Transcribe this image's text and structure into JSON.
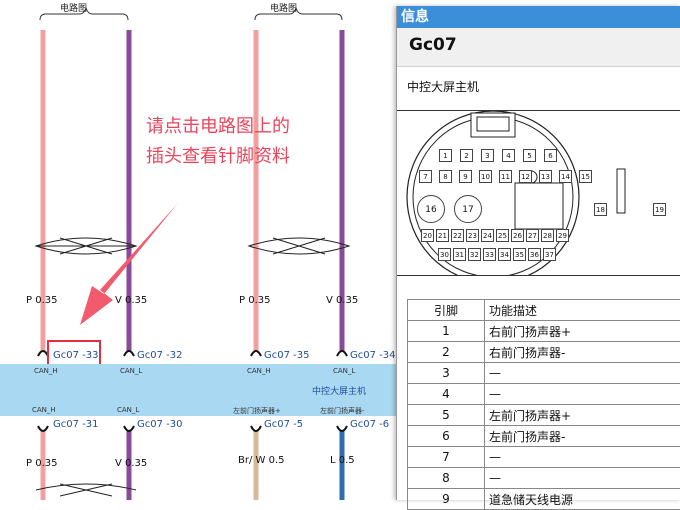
{
  "diagram": {
    "group_label_left": "电路图",
    "group_label_right": "电路图",
    "wires_top": [
      {
        "gauge": "P 0.35",
        "pin": "Gc07 -33",
        "signal": "CAN_H",
        "color": "#f0a0a0"
      },
      {
        "gauge": "V 0.35",
        "pin": "Gc07 -32",
        "signal": "CAN_L",
        "color": "#8a4a9a"
      },
      {
        "gauge": "P 0.35",
        "pin": "Gc07 -35",
        "signal": "CAN_H",
        "color": "#f0a0a0"
      },
      {
        "gauge": "V 0.35",
        "pin": "Gc07 -34",
        "signal": "CAN_L",
        "color": "#8a4a9a"
      }
    ],
    "wires_bottom": [
      {
        "gauge": "P 0.35",
        "pin": "Gc07 -31",
        "signal": "CAN_H"
      },
      {
        "gauge": "V 0.35",
        "pin": "Gc07 -30",
        "signal": "CAN_L"
      },
      {
        "gauge": "Br/ W 0.5",
        "pin": "Gc07 -5",
        "signal": "左前门扬声器+"
      },
      {
        "gauge": "L 0.5",
        "pin": "Gc07 -6",
        "signal": "左前门扬声器-"
      }
    ],
    "module_name": "中控大屏主机",
    "hint_line1": "请点击电路图上的",
    "hint_line2": "插头查看针脚资料"
  },
  "info_panel": {
    "title": "信息",
    "connector_code": "Gc07",
    "connector_desc": "中控大屏主机",
    "pins_row1": [
      "1",
      "2",
      "3",
      "4",
      "5",
      "6"
    ],
    "pins_row2": [
      "7",
      "8",
      "9",
      "10",
      "11",
      "12",
      "13",
      "14",
      "15"
    ],
    "pins_round": [
      "16",
      "17"
    ],
    "pins_mid": [
      "18",
      "19"
    ],
    "pins_row3": [
      "20",
      "21",
      "22",
      "23",
      "24",
      "25",
      "26",
      "27",
      "28",
      "29"
    ],
    "pins_row4": [
      "30",
      "31",
      "32",
      "33",
      "34",
      "35",
      "36",
      "37"
    ],
    "table_header": [
      "引脚",
      "功能描述"
    ],
    "table_rows": [
      [
        "1",
        "右前门扬声器+"
      ],
      [
        "2",
        "右前门扬声器-"
      ],
      [
        "3",
        "—"
      ],
      [
        "4",
        "—"
      ],
      [
        "5",
        "左前门扬声器+"
      ],
      [
        "6",
        "左前门扬声器-"
      ],
      [
        "7",
        "—"
      ],
      [
        "8",
        "—"
      ],
      [
        "9",
        "道急储天线电源"
      ]
    ]
  }
}
